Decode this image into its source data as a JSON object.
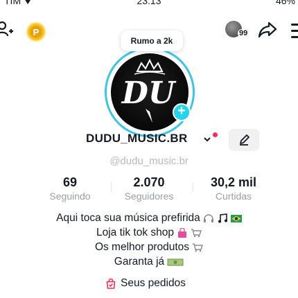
{
  "status_bar": {
    "carrier": "TIM",
    "time": "23:13",
    "battery": "46%"
  },
  "top_bar": {
    "profile_visitors": "99"
  },
  "avatar": {
    "goal_bubble": "Rumo a 2k",
    "logo_text": "DU"
  },
  "profile": {
    "username": "DUDU_MUSIC.BR",
    "handle": "@dudu_music.br"
  },
  "stats": [
    {
      "value": "69",
      "label": "Seguindo"
    },
    {
      "value": "2.070",
      "label": "Seguidores"
    },
    {
      "value": "30,2 mil",
      "label": "Curtidas"
    }
  ],
  "bio": {
    "line1": "Aqui toca sua música prefirida",
    "line2": "Loja tik tok shop",
    "line3": "Os melhor produtos",
    "line4": "Garanta já"
  },
  "orders": {
    "label": "Seus pedidos"
  },
  "colors": {
    "accent_ring": "#39c4e8",
    "plus_badge": "#20d5ec",
    "notification_dot": "#fe2c55",
    "coin": "#f9c11c"
  },
  "icons": [
    "add-user-icon",
    "coin-icon",
    "share-icon",
    "menu-icon",
    "pencil-icon",
    "headphones-icon",
    "music-note-icon",
    "brazil-flag-icon",
    "shopping-bag-icon",
    "cart-icon",
    "money-icon",
    "orders-bag-icon"
  ]
}
